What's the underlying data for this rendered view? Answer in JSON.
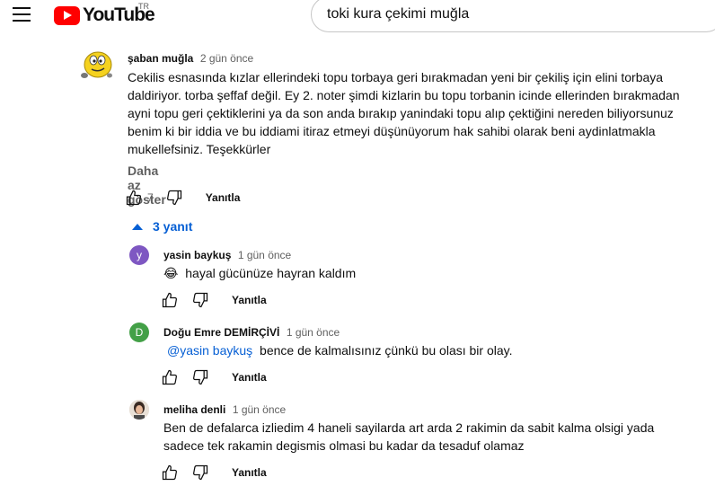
{
  "header": {
    "logo_text": "YouTube",
    "country_code": "TR",
    "search_value": "toki kura çekimi muğla"
  },
  "main_comment": {
    "author": "şaban muğla",
    "time": "2 gün önce",
    "text": "Cekilis esnasında kızlar ellerindeki topu torbaya geri bırakmadan yeni bir çekiliş için elini torbaya daldiriyor. torba şeffaf değil. Ey 2. noter şimdi kizlarin bu topu torbanin icinde ellerinden bırakmadan ayni topu geri çektiklerini ya da son anda bırakıp yanindaki topu alıp çektiğini nereden  biliyorsunuz benim ki bir iddia ve bu iddiami itiraz etmeyi düşünüyorum hak sahibi olarak beni aydinlatmakla mukellefsiniz. Teşekkürler",
    "show_less": "Daha az göster",
    "likes": "7",
    "reply_label": "Yanıtla"
  },
  "replies_toggle": "3 yanıt",
  "replies": [
    {
      "author": "yasin baykuş",
      "time": "1 gün önce",
      "avatar_letter": "y",
      "avatar_color": "#7e57c2",
      "emoji": "😂",
      "text": "hayal gücünüze hayran kaldım",
      "reply_label": "Yanıtla"
    },
    {
      "author": "Doğu Emre DEMİRÇİVİ",
      "time": "1 gün önce",
      "avatar_letter": "D",
      "avatar_color": "#43a047",
      "mention": "@yasin baykuş",
      "text": "bence de kalmalısınız çünkü bu olası bir olay.",
      "reply_label": "Yanıtla"
    },
    {
      "author": "meliha denli",
      "time": "1 gün önce",
      "text_line1": "Ben de defalarca izliedim 4 haneli sayilarda art arda 2 rakimin da sabit kalma olsigi yada",
      "text_line2": "sadece tek rakamin degismis olmasi bu kadar da tesaduf olamaz",
      "reply_label": "Yanıtla"
    }
  ],
  "colors": {
    "link": "#065fd4",
    "brand": "#ff0000",
    "secondary_text": "#606060"
  }
}
